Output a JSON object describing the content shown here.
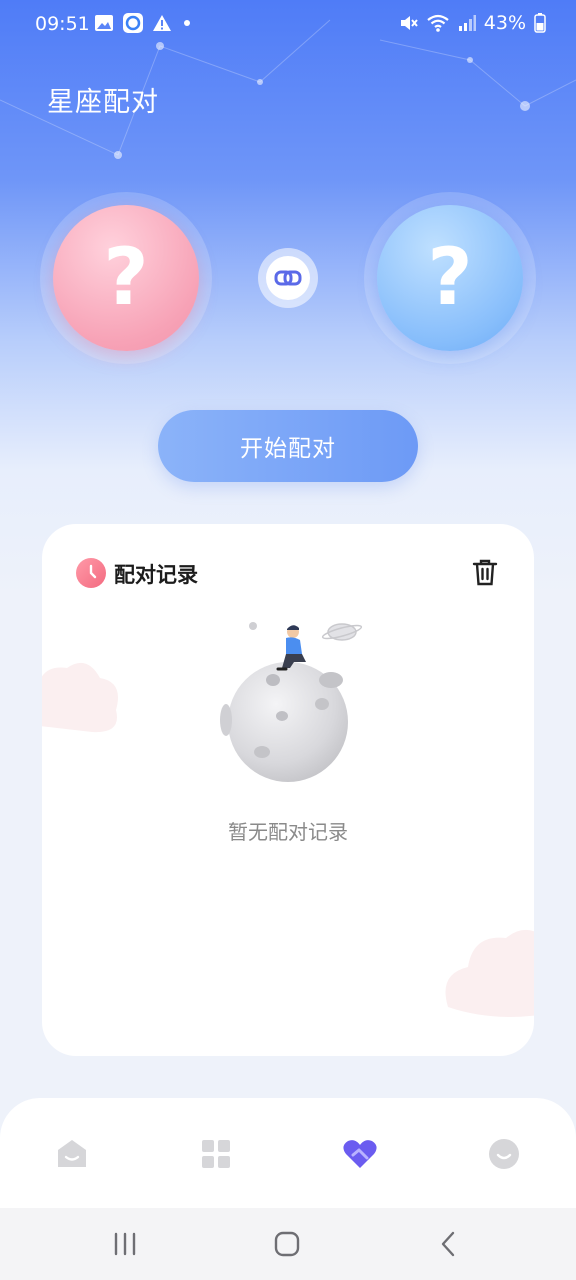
{
  "status_bar": {
    "time": "09:51",
    "battery": "43%",
    "left_icons": [
      "image-icon",
      "app-icon",
      "warning-icon",
      "dot-icon"
    ],
    "right_icons": [
      "mute-icon",
      "wifi-icon",
      "signal-icon",
      "battery-icon"
    ]
  },
  "page": {
    "title": "星座配对"
  },
  "pairing": {
    "left_symbol": "?",
    "right_symbol": "?",
    "link_icon": "link-icon",
    "start_label": "开始配对"
  },
  "record": {
    "title": "配对记录",
    "empty_text": "暂无配对记录",
    "delete_icon": "trash-icon"
  },
  "bottom_nav": {
    "items": [
      "home-icon",
      "grid-icon",
      "heart-pair-icon",
      "profile-icon"
    ],
    "active_index": 2,
    "active_color": "#6b5cf0",
    "inactive_color": "#d6d6d9"
  },
  "colors": {
    "accent": "#6d9af6",
    "pink": "#f7a2b6",
    "blue": "#86bdfb"
  }
}
